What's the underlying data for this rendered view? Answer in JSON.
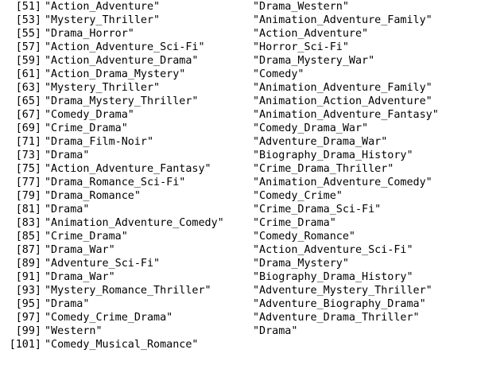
{
  "console": {
    "rows": [
      {
        "index": "[51]",
        "left": "\"Action_Adventure\"",
        "right": "\"Drama_Western\""
      },
      {
        "index": "[53]",
        "left": "\"Mystery_Thriller\"",
        "right": "\"Animation_Adventure_Family\""
      },
      {
        "index": "[55]",
        "left": "\"Drama_Horror\"",
        "right": "\"Action_Adventure\""
      },
      {
        "index": "[57]",
        "left": "\"Action_Adventure_Sci-Fi\"",
        "right": "\"Horror_Sci-Fi\""
      },
      {
        "index": "[59]",
        "left": "\"Action_Adventure_Drama\"",
        "right": "\"Drama_Mystery_War\""
      },
      {
        "index": "[61]",
        "left": "\"Action_Drama_Mystery\"",
        "right": "\"Comedy\""
      },
      {
        "index": "[63]",
        "left": "\"Mystery_Thriller\"",
        "right": "\"Animation_Adventure_Family\""
      },
      {
        "index": "[65]",
        "left": "\"Drama_Mystery_Thriller\"",
        "right": "\"Animation_Action_Adventure\""
      },
      {
        "index": "[67]",
        "left": "\"Comedy_Drama\"",
        "right": "\"Animation_Adventure_Fantasy\""
      },
      {
        "index": "[69]",
        "left": "\"Crime_Drama\"",
        "right": "\"Comedy_Drama_War\""
      },
      {
        "index": "[71]",
        "left": "\"Drama_Film-Noir\"",
        "right": "\"Adventure_Drama_War\""
      },
      {
        "index": "[73]",
        "left": "\"Drama\"",
        "right": "\"Biography_Drama_History\""
      },
      {
        "index": "[75]",
        "left": "\"Action_Adventure_Fantasy\"",
        "right": "\"Crime_Drama_Thriller\""
      },
      {
        "index": "[77]",
        "left": "\"Drama_Romance_Sci-Fi\"",
        "right": "\"Animation_Adventure_Comedy\""
      },
      {
        "index": "[79]",
        "left": "\"Drama_Romance\"",
        "right": "\"Comedy_Crime\""
      },
      {
        "index": "[81]",
        "left": "\"Drama\"",
        "right": "\"Crime_Drama_Sci-Fi\""
      },
      {
        "index": "[83]",
        "left": "\"Animation_Adventure_Comedy\"",
        "right": "\"Crime_Drama\""
      },
      {
        "index": "[85]",
        "left": "\"Crime_Drama\"",
        "right": "\"Comedy_Romance\""
      },
      {
        "index": "[87]",
        "left": "\"Drama_War\"",
        "right": "\"Action_Adventure_Sci-Fi\""
      },
      {
        "index": "[89]",
        "left": "\"Adventure_Sci-Fi\"",
        "right": "\"Drama_Mystery\""
      },
      {
        "index": "[91]",
        "left": "\"Drama_War\"",
        "right": "\"Biography_Drama_History\""
      },
      {
        "index": "[93]",
        "left": "\"Mystery_Romance_Thriller\"",
        "right": "\"Adventure_Mystery_Thriller\""
      },
      {
        "index": "[95]",
        "left": "\"Drama\"",
        "right": "\"Adventure_Biography_Drama\""
      },
      {
        "index": "[97]",
        "left": "\"Comedy_Crime_Drama\"",
        "right": "\"Adventure_Drama_Thriller\""
      },
      {
        "index": "[99]",
        "left": "\"Western\"",
        "right": "\"Drama\""
      },
      {
        "index": "[101]",
        "left": "\"Comedy_Musical_Romance\"",
        "right": ""
      }
    ]
  }
}
